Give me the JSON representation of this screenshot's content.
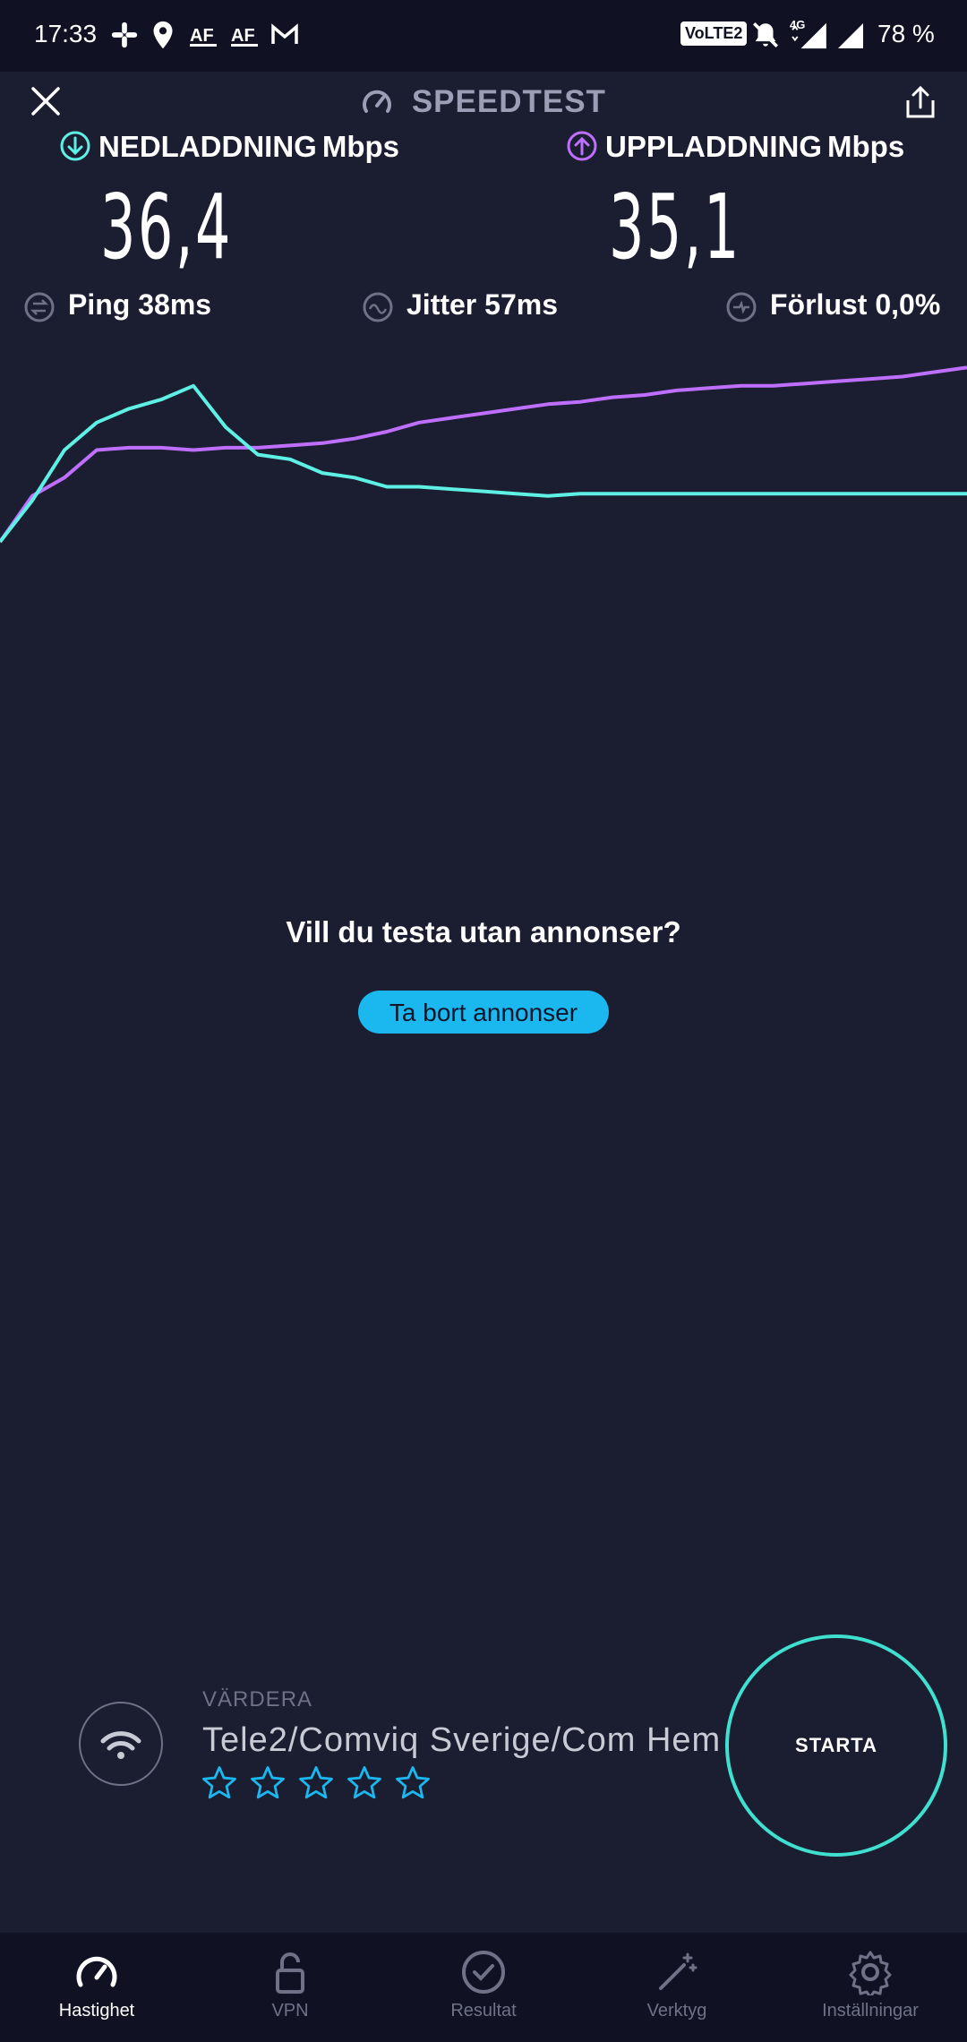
{
  "status_bar": {
    "time": "17:33",
    "volte": "VoLTE2",
    "network": "4G",
    "battery": "78 %",
    "icons": [
      "slack-icon",
      "location-icon",
      "app-icon",
      "app-icon",
      "gmail-icon",
      "mute-icon",
      "signal-icon",
      "signal-icon"
    ]
  },
  "header": {
    "title": "SPEEDTEST",
    "close_icon": "close-icon",
    "share_icon": "share-icon"
  },
  "download": {
    "label": "NEDLADDNING",
    "unit": "Mbps",
    "value": "36,4",
    "color": "#5ef0e4"
  },
  "upload": {
    "label": "UPPLADDNING",
    "unit": "Mbps",
    "value": "35,1",
    "color": "#bf6fff"
  },
  "stats": {
    "ping": "Ping 38ms",
    "jitter": "Jitter 57ms",
    "loss": "Förlust 0,0%"
  },
  "graph": {
    "download_series": [
      0,
      18,
      40,
      52,
      58,
      62,
      68,
      50,
      38,
      36,
      30,
      28,
      24,
      24,
      23,
      22,
      21,
      20,
      21,
      21,
      21,
      21,
      21,
      21,
      21,
      21,
      21,
      21,
      21,
      21,
      21
    ],
    "upload_series": [
      0,
      20,
      28,
      40,
      41,
      41,
      40,
      41,
      41,
      42,
      43,
      45,
      48,
      52,
      54,
      56,
      58,
      60,
      61,
      63,
      64,
      66,
      67,
      68,
      68,
      69,
      70,
      71,
      72,
      74,
      76
    ],
    "download_color": "#5ef0e4",
    "upload_color": "#bf6fff"
  },
  "ad": {
    "title": "Vill du testa utan annonser?",
    "button": "Ta bort annonser"
  },
  "provider": {
    "rate_label": "VÄRDERA",
    "name": "Tele2/Comviq Sverige/Com Hem",
    "rating": 0,
    "max_rating": 5,
    "star_color": "#1bb8ef"
  },
  "start_button": "STARTA",
  "nav": [
    {
      "label": "Hastighet",
      "icon": "speed-icon",
      "active": true
    },
    {
      "label": "VPN",
      "icon": "lock-icon",
      "active": false
    },
    {
      "label": "Resultat",
      "icon": "check-circle-icon",
      "active": false
    },
    {
      "label": "Verktyg",
      "icon": "magic-wand-icon",
      "active": false
    },
    {
      "label": "Inställningar",
      "icon": "gear-icon",
      "active": false
    }
  ]
}
